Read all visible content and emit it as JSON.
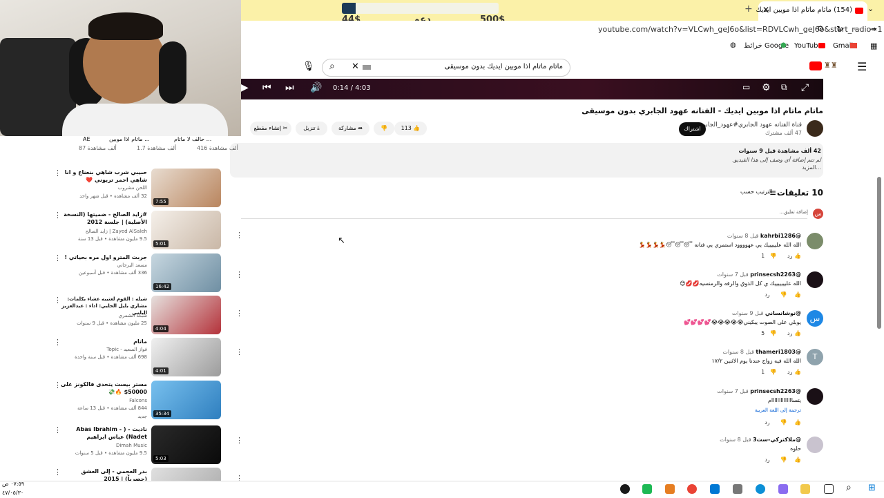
{
  "browser": {
    "donation": {
      "left": "44$",
      "center": "دعم",
      "right": "500$",
      "progress": 0.088
    },
    "tab_title": "(154) ماتام ماتام اذا موبين ايديك",
    "url": "youtube.com/watch?v=VLCwh_geJ6o&list=RDVLCwh_geJ6o&start_radio=1",
    "bookmarks": [
      "Gmail",
      "YouTube",
      "خرائط Google"
    ]
  },
  "header": {
    "search_value": "ماتام ماتام اذا موبين ايديك بدون موسيقى"
  },
  "player": {
    "time": "0:14 / 4:03"
  },
  "video": {
    "title": "ماتام ماتام اذا موبين ايديك - الفنانه عهود الجابري بدون موسيقى",
    "channel": "قناة الفنانه عهود الجابري#عهود_الجابري",
    "subs": "47 ألف مشترك",
    "subscribe": "اشتراك",
    "likes": "113",
    "share": "مشاركة",
    "download": "تنزيل",
    "clip": "إنشاء مقطع"
  },
  "description": {
    "meta": "42 ألف مشاهدة  قبل 9 سنوات",
    "text": "لم تتم إضافة أي وصف إلى هذا الفيديو.",
    "more": "...المزيد"
  },
  "comments": {
    "count": "10 تعليقات",
    "sort": "الترتيب حسب",
    "add_placeholder": "إضافة تعليق...",
    "my_avatar": "س",
    "items": [
      {
        "author": "@kahrbi1286",
        "age": "قبل 8 سنوات",
        "text": "الله الله عليييييك يي عهوووود استمري يي فنانه 😴😴😴💃💃💃💃",
        "likes": "1",
        "reply": "رد"
      },
      {
        "author": "@prinsecsh2263",
        "age": "قبل 7 سنوات",
        "text": "الله عليييييييك ي كل الذوق والرقه والرمنسيه💋💋😍",
        "likes": "",
        "reply": "رد"
      },
      {
        "author": "@نوشانساني",
        "age": "قبل 9 سنوات",
        "text": "يوبلي على الصوت يبكيني😭😭😭😭😭💕💕💕💕",
        "likes": "5",
        "reply": "رد",
        "avatar_letter": "س"
      },
      {
        "author": "@thameri1803",
        "age": "قبل 8 سنوات",
        "text": "الله الله فيه زواج عندنا يوم الاثنين ١٧/٢",
        "likes": "1",
        "reply": "رد",
        "avatar_letter": "T"
      },
      {
        "author": "@prinsecsh2263",
        "age": "قبل 7 سنوات",
        "text": "يتساااااااااااااام",
        "translate": "ترجمة إلى اللغة العربية",
        "likes": "",
        "reply": "رد"
      },
      {
        "author": "@ملاكتركي-ست3",
        "age": "قبل 8 سنوات",
        "text": "حلوه",
        "likes": "",
        "reply": "رد"
      }
    ]
  },
  "sidebar": {
    "top": [
      {
        "title": "حالف لا ماتام ...",
        "views": "416 ألف مشاهدة"
      },
      {
        "title": "ماتام اذا موبين ...",
        "views": "1.7 ألف مشاهدة"
      },
      {
        "title": "AE",
        "views": "87 ألف مشاهدة"
      }
    ],
    "videos": [
      {
        "title": "حبيبي شرب شاهي بنعناع و انا شاهي احمر تربوني ❤️",
        "channel": "اللحن مشروب",
        "stats": "32 ألف مشاهدة • قبل شهر واحد",
        "duration": "7:55",
        "thumb": "#c9a98a"
      },
      {
        "title": "#زايد الصالح - ضميتها (النسخة الأصلية) | جلسة 2012",
        "channel": "Zayed AlSaleh | زايد الصالح",
        "stats": "9.5 مليون مشاهدة • قبل 13 سنة",
        "duration": "5:01",
        "thumb": "#e8e2dc"
      },
      {
        "title": "جربت المترو اول مره بحياتي !",
        "channel": "مسعد البرجاني",
        "stats": "336 ألف مشاهدة • قبل أسبوعين",
        "duration": "16:42",
        "thumb": "#9fb6c4"
      },
      {
        "title": "شيله : القوم لعتيبه عشاء بكلمات: مشاري بليل الحلبي: اداء : عبدالعزيز اليامي",
        "channel": "شبكة الشمري",
        "stats": "25 مليون مشاهدة • قبل 9 سنوات",
        "duration": "4:04",
        "thumb": "#b4323a"
      },
      {
        "title": "ماتام",
        "channel": "فواز السعيد - Topic",
        "stats": "698 ألف مشاهدة • قبل سنة واحدة",
        "duration": "4:01",
        "thumb": "#d8d8d8"
      },
      {
        "title": "مستر بيست يتحدى فالكونز على 50000$ 🔥💸",
        "channel": "Falcons",
        "stats": "844 ألف مشاهدة • قبل 13 ساعة",
        "badge": "جديد",
        "duration": "35:34",
        "thumb": "#4b9fd6"
      },
      {
        "title": "ناديت - ( Abas Ibrahim - Nadet) عباس ابراهيم",
        "channel": "Dimah Music",
        "stats": "9.5 مليون مشاهدة • قبل 5 سنوات",
        "duration": "5:03",
        "thumb": "#1a1a1a"
      },
      {
        "title": "بدر العجمي - إلى العشق (حصرياً) | 2015",
        "channel": "",
        "stats": "",
        "duration": "",
        "thumb": "#cfcfcf"
      }
    ]
  },
  "taskbar": {
    "time": "٠٧:٥٩ ص",
    "date": "٤٧/٠٥/٣٠"
  },
  "colors": {
    "accent": "#ff0000",
    "chrome_yellow": "#fbf1a8",
    "player_bg": "#2a0c1c"
  }
}
